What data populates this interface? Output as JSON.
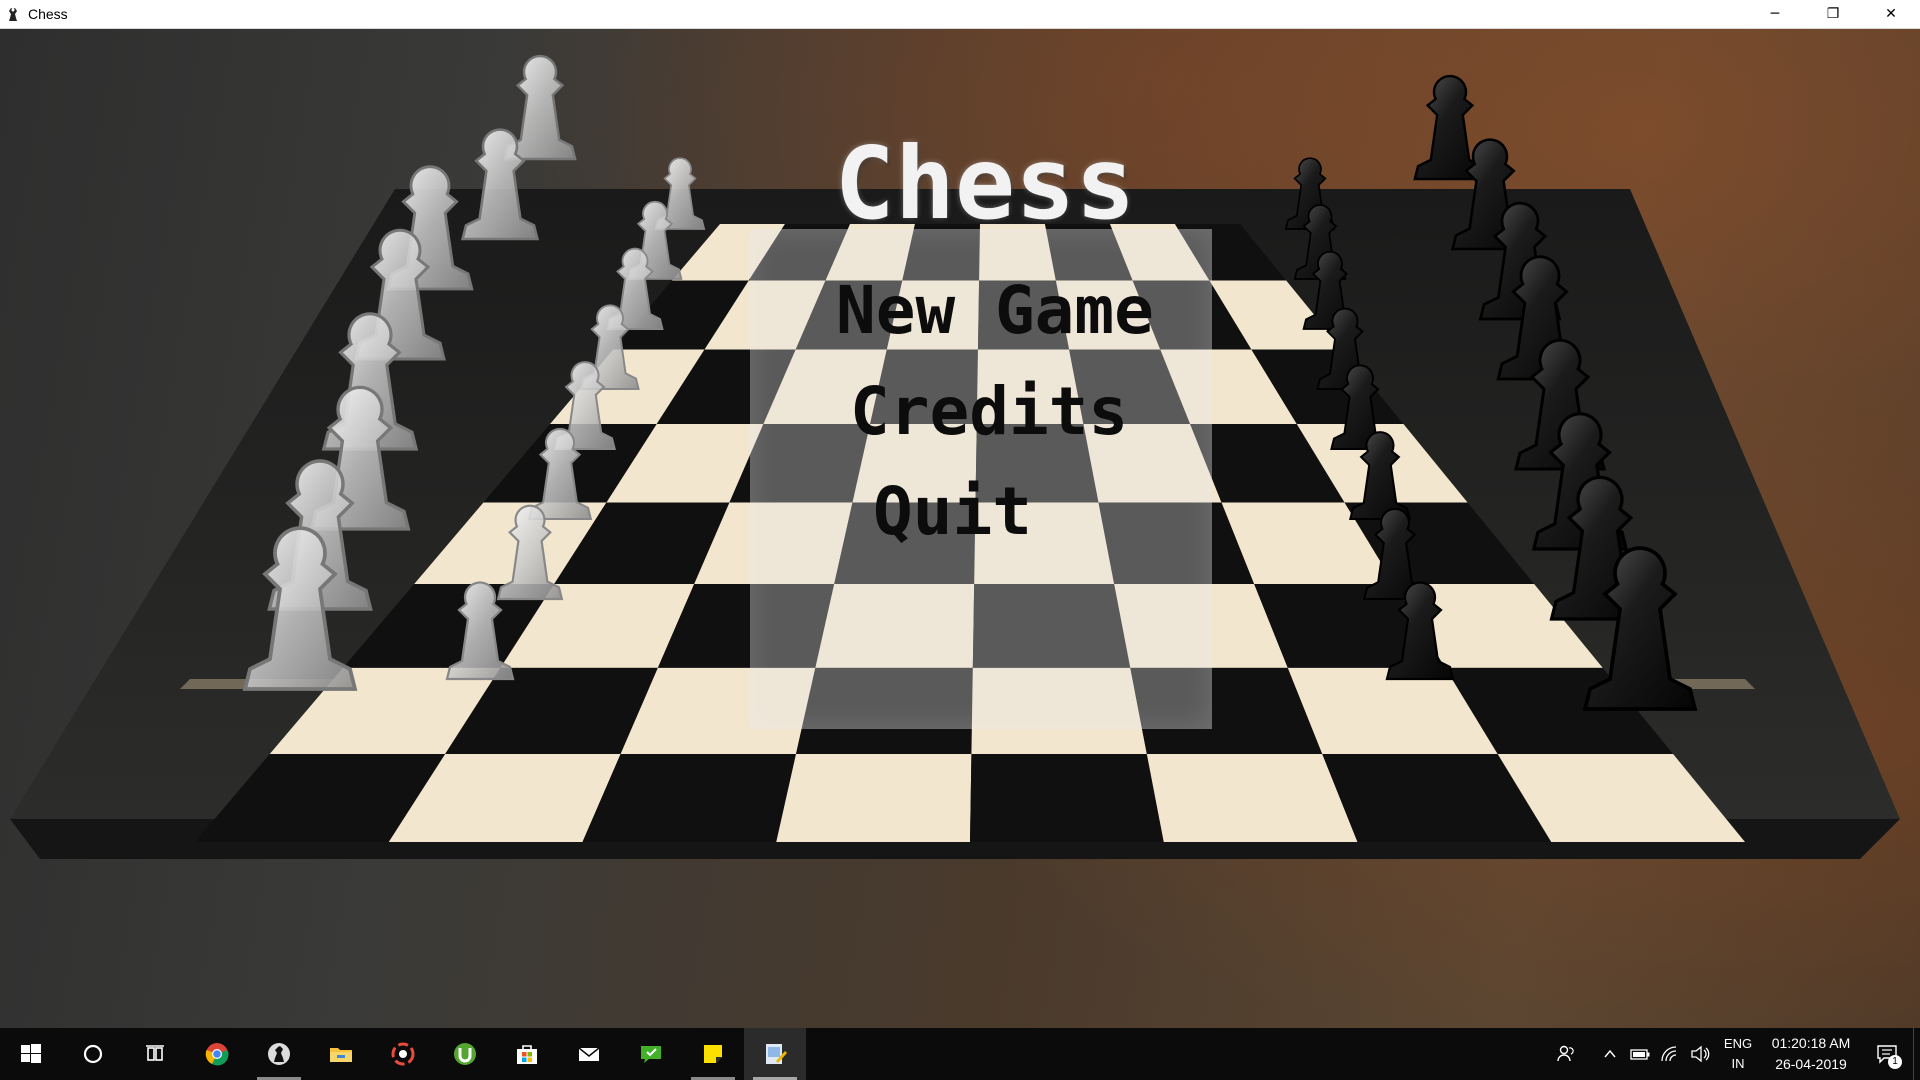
{
  "window": {
    "title": "Chess",
    "controls": {
      "minimize": "─",
      "restore": "❐",
      "close": "✕"
    }
  },
  "menu": {
    "title": "Chess",
    "items": [
      {
        "label": "New Game"
      },
      {
        "label": "Credits"
      },
      {
        "label": "Quit"
      }
    ]
  },
  "taskbar": {
    "apps": [
      {
        "icon": "start-windows-icon",
        "running": false
      },
      {
        "icon": "cortana-search-icon",
        "running": false
      },
      {
        "icon": "task-view-icon",
        "running": false
      },
      {
        "icon": "chrome-icon",
        "running": false
      },
      {
        "icon": "chess-app-icon",
        "running": true
      },
      {
        "icon": "file-explorer-icon",
        "running": false
      },
      {
        "icon": "photoscape-icon",
        "running": false
      },
      {
        "icon": "utorrent-icon",
        "running": false
      },
      {
        "icon": "microsoft-store-icon",
        "running": false
      },
      {
        "icon": "mail-icon",
        "running": false
      },
      {
        "icon": "gif-app-icon",
        "running": false
      },
      {
        "icon": "sticky-notes-icon",
        "running": true
      },
      {
        "icon": "paint-app-icon",
        "running": true,
        "active": true
      }
    ],
    "tray": {
      "language": {
        "line1": "ENG",
        "line2": "IN"
      },
      "clock": {
        "time": "01:20:18 AM",
        "date": "26-04-2019"
      },
      "notifications_count": "1"
    }
  },
  "colors": {
    "menu_title": "#f2f2f2",
    "menu_item": "#0c0c0c",
    "taskbar_bg": "#0b0b0b",
    "board_light": "#f3e6cf",
    "board_dark": "#101010"
  }
}
